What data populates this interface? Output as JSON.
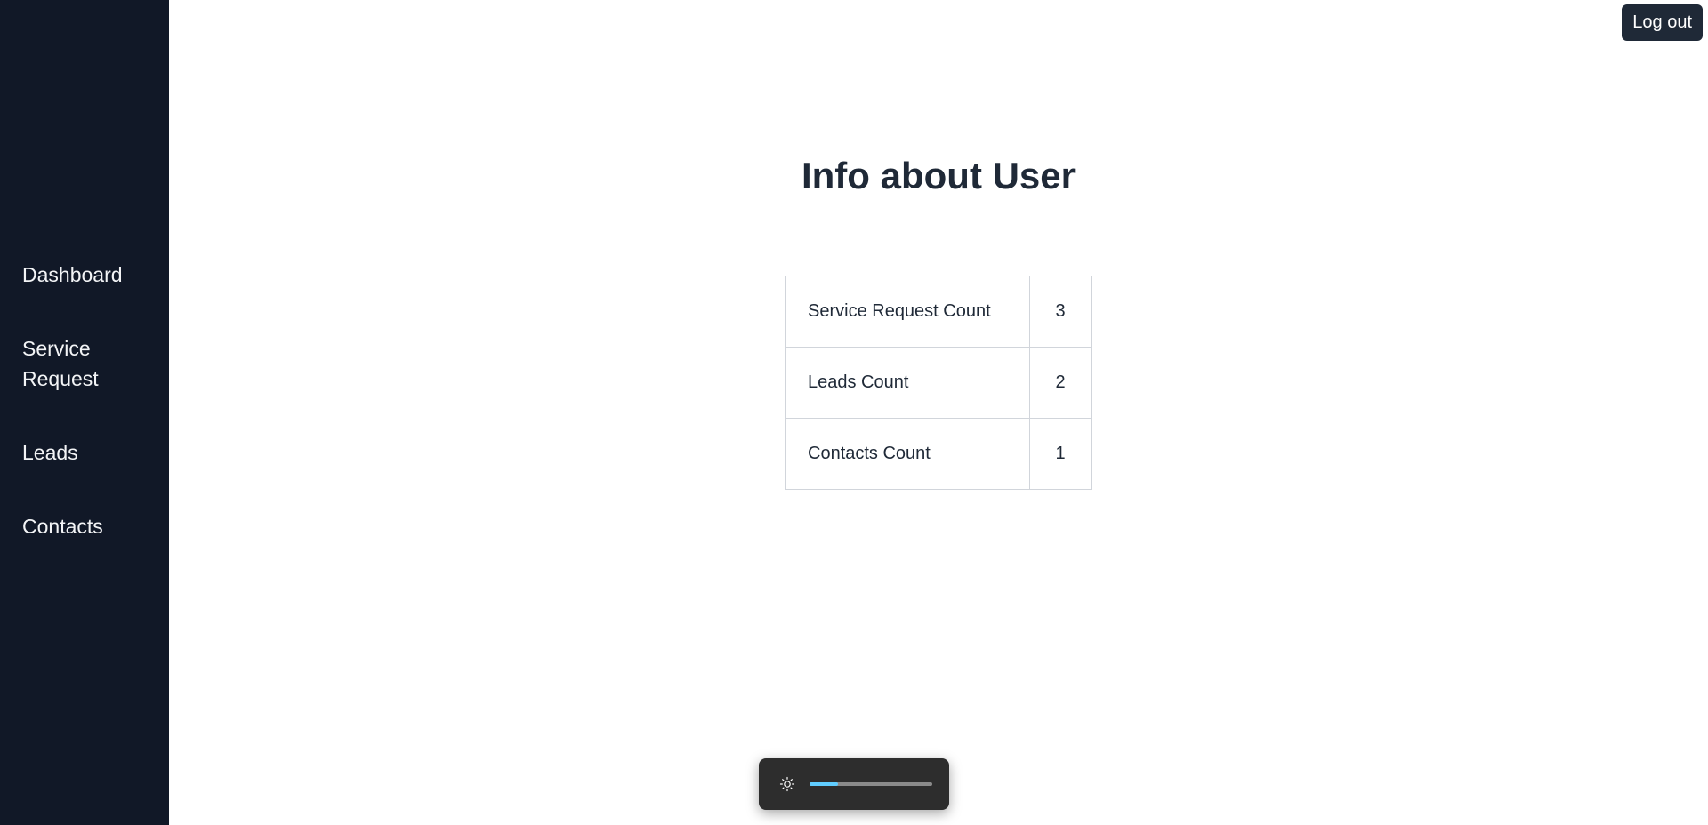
{
  "sidebar": {
    "items": [
      {
        "label": "Dashboard"
      },
      {
        "label": "Service Request"
      },
      {
        "label": "Leads"
      },
      {
        "label": "Contacts"
      }
    ]
  },
  "header": {
    "logout_label": "Log out"
  },
  "main": {
    "title": "Info about User",
    "rows": [
      {
        "label": "Service Request Count",
        "value": "3"
      },
      {
        "label": "Leads Count",
        "value": "2"
      },
      {
        "label": "Contacts Count",
        "value": "1"
      }
    ]
  },
  "brightness_flyout": {
    "icon": "sun-icon",
    "level": 0.23,
    "accent_color": "#60cdff"
  },
  "colors": {
    "sidebar_bg": "#111827",
    "button_bg": "#1f2937",
    "text": "#1f2937"
  }
}
